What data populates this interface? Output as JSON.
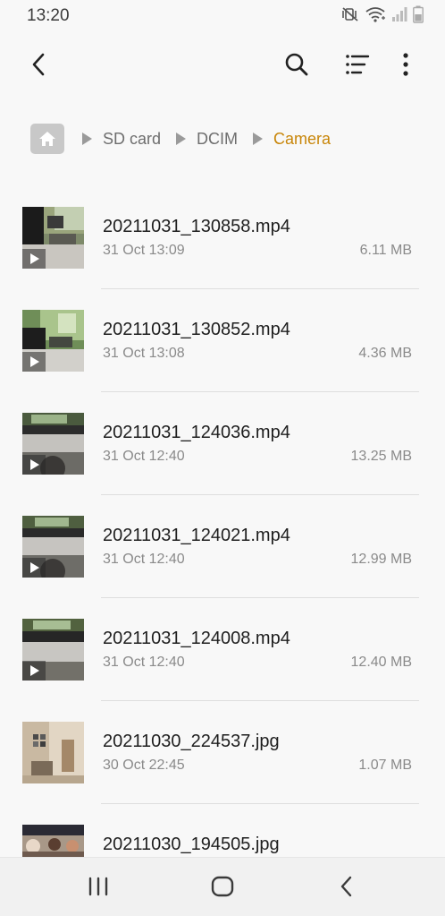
{
  "status_bar": {
    "time": "13:20",
    "icons": [
      "mute-vibrate-icon",
      "wifi-icon",
      "signal-icon",
      "battery-icon"
    ]
  },
  "app_bar": {
    "icons": [
      "back-arrow-icon",
      "search-icon",
      "list-view-icon",
      "more-options-icon"
    ]
  },
  "breadcrumb": {
    "home_icon": "home-icon",
    "items": [
      {
        "label": "SD card",
        "current": false
      },
      {
        "label": "DCIM",
        "current": false
      },
      {
        "label": "Camera",
        "current": true
      }
    ]
  },
  "files": [
    {
      "name": "20211031_130858.mp4",
      "date": "31 Oct 13:09",
      "size": "6.11 MB",
      "type": "video"
    },
    {
      "name": "20211031_130852.mp4",
      "date": "31 Oct 13:08",
      "size": "4.36 MB",
      "type": "video"
    },
    {
      "name": "20211031_124036.mp4",
      "date": "31 Oct 12:40",
      "size": "13.25 MB",
      "type": "video"
    },
    {
      "name": "20211031_124021.mp4",
      "date": "31 Oct 12:40",
      "size": "12.99 MB",
      "type": "video"
    },
    {
      "name": "20211031_124008.mp4",
      "date": "31 Oct 12:40",
      "size": "12.40 MB",
      "type": "video"
    },
    {
      "name": "20211030_224537.jpg",
      "date": "30 Oct 22:45",
      "size": "1.07 MB",
      "type": "image"
    },
    {
      "name": "20211030_194505.jpg",
      "date": "",
      "size": "",
      "type": "image"
    }
  ],
  "nav_bar": {
    "icons": [
      "recent-apps-icon",
      "home-icon",
      "back-icon"
    ]
  },
  "colors": {
    "accent": "#c8860a",
    "background": "#f8f8f8",
    "divider": "#dedede"
  }
}
